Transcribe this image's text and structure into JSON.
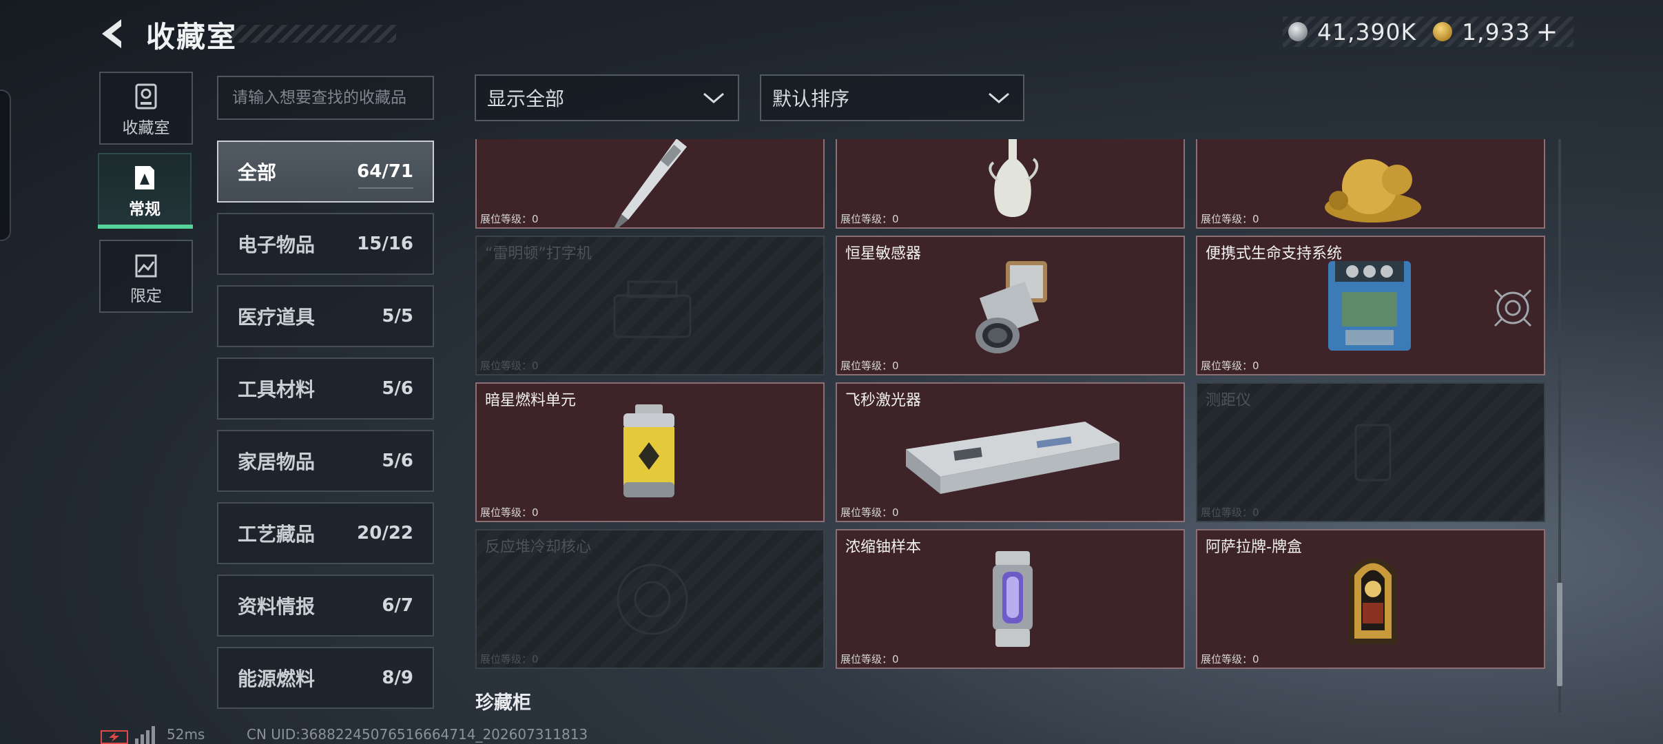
{
  "header": {
    "title": "收藏室",
    "silver_amount": "41,390K",
    "gold_amount": "1,933",
    "add_symbol": "+"
  },
  "nav": [
    {
      "label": "收藏室",
      "icon": "collection-room-icon",
      "active": false
    },
    {
      "label": "常规",
      "icon": "regular-document-icon",
      "active": true
    },
    {
      "label": "限定",
      "icon": "limited-image-icon",
      "active": false
    }
  ],
  "search": {
    "placeholder": "请输入想要查找的收藏品"
  },
  "categories": [
    {
      "name": "全部",
      "count": "64/71",
      "active": true
    },
    {
      "name": "电子物品",
      "count": "15/16"
    },
    {
      "name": "医疗道具",
      "count": "5/5"
    },
    {
      "name": "工具材料",
      "count": "5/6"
    },
    {
      "name": "家居物品",
      "count": "5/6"
    },
    {
      "name": "工艺藏品",
      "count": "20/22"
    },
    {
      "name": "资料情报",
      "count": "6/7"
    },
    {
      "name": "能源燃料",
      "count": "8/9"
    }
  ],
  "filters": {
    "display": "显示全部",
    "sort": "默认排序"
  },
  "items": [
    {
      "name": "",
      "level": "展位等级：0",
      "owned": true,
      "icon": "pen-icon"
    },
    {
      "name": "",
      "level": "展位等级：0",
      "owned": true,
      "icon": "porcelain-vase-icon"
    },
    {
      "name": "",
      "level": "展位等级：0",
      "owned": true,
      "icon": "golden-statue-icon"
    },
    {
      "name": "“雷明顿”打字机",
      "level": "展位等级：0",
      "owned": false,
      "icon": "typewriter-icon"
    },
    {
      "name": "恒星敏感器",
      "level": "展位等级：0",
      "owned": true,
      "icon": "star-sensor-icon"
    },
    {
      "name": "便携式生命支持系统",
      "level": "展位等级：0",
      "owned": true,
      "icon": "life-support-icon"
    },
    {
      "name": "暗星燃料单元",
      "level": "展位等级：0",
      "owned": true,
      "icon": "fuel-canister-icon"
    },
    {
      "name": "飞秒激光器",
      "level": "展位等级：0",
      "owned": true,
      "icon": "laser-device-icon"
    },
    {
      "name": "测距仪",
      "level": "展位等级：0",
      "owned": false,
      "icon": "rangefinder-icon"
    },
    {
      "name": "反应堆冷却核心",
      "level": "展位等级：0",
      "owned": false,
      "icon": "reactor-core-icon"
    },
    {
      "name": "浓缩铀样本",
      "level": "展位等级：0",
      "owned": true,
      "icon": "uranium-sample-icon"
    },
    {
      "name": "阿萨拉牌-牌盒",
      "level": "展位等级：0",
      "owned": true,
      "icon": "card-box-icon"
    }
  ],
  "section_title": "珍藏柜",
  "status": {
    "ping": "52ms",
    "uid": "CN UID:36882245076516664714_202607311813"
  },
  "colors": {
    "owned_card_bg": "#3e2329",
    "owned_card_border": "#8a6f74",
    "active_accent": "#55d39a"
  }
}
